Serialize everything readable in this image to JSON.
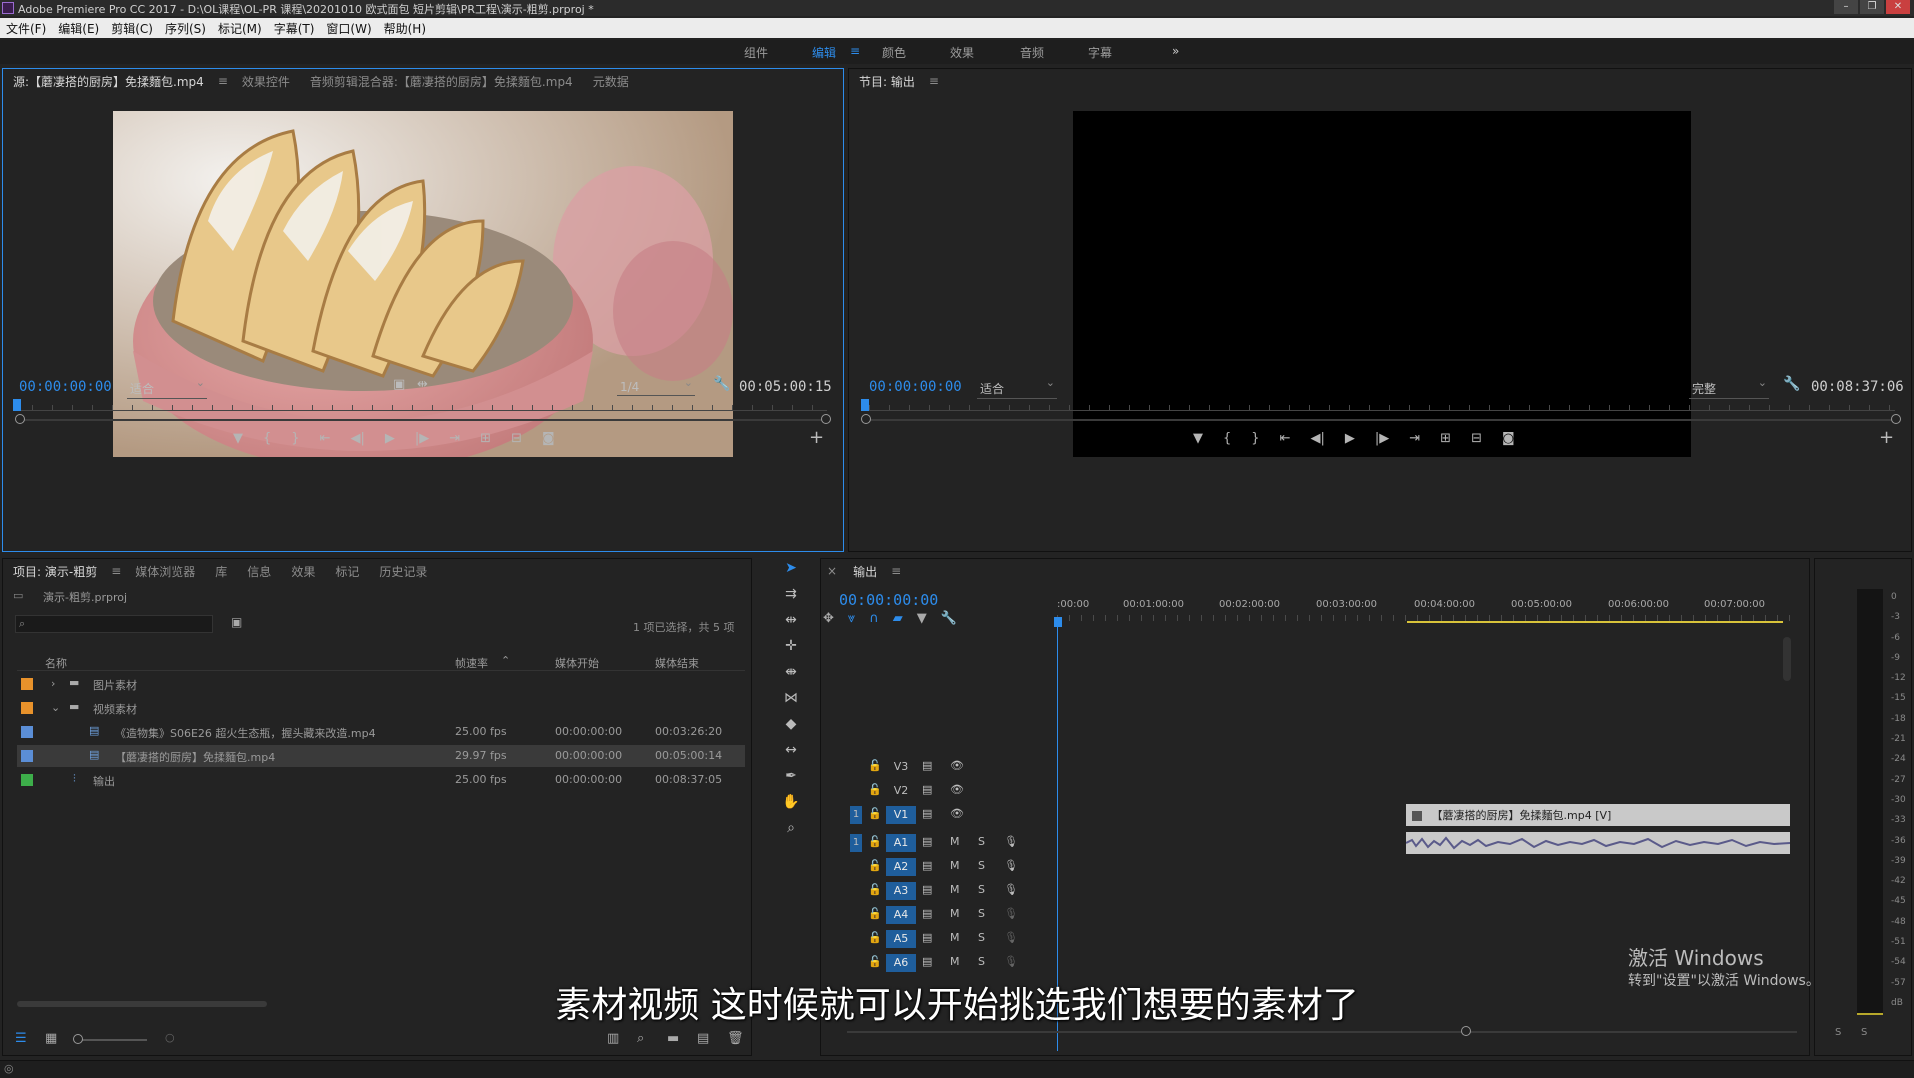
{
  "window": {
    "title": "Adobe Premiere Pro CC 2017 - D:\\OL课程\\OL-PR 课程\\20201010 欧式面包 短片剪辑\\PR工程\\演示-粗剪.prproj *"
  },
  "menu": [
    "文件(F)",
    "编辑(E)",
    "剪辑(C)",
    "序列(S)",
    "标记(M)",
    "字幕(T)",
    "窗口(W)",
    "帮助(H)"
  ],
  "workspaces": [
    "组件",
    "编辑",
    "颜色",
    "效果",
    "音频",
    "字幕"
  ],
  "workspace_active": "编辑",
  "workspace_more": "»",
  "source_panel": {
    "tabs": [
      "源:【蘑凄搭的厨房】免揉麵包.mp4",
      "效果控件",
      "音频剪辑混合器:【蘑凄搭的厨房】免揉麵包.mp4",
      "元数据"
    ],
    "timecode": "00:00:00:00",
    "fit": "适合",
    "resolution": "1/4",
    "duration": "00:05:00:15"
  },
  "program_panel": {
    "title": "节目: 输出",
    "timecode": "00:00:00:00",
    "fit": "适合",
    "quality": "完整",
    "duration": "00:08:37:06"
  },
  "project_panel": {
    "tabs": [
      "项目: 演示-粗剪",
      "媒体浏览器",
      "库",
      "信息",
      "效果",
      "标记",
      "历史记录"
    ],
    "file": "演示-粗剪.prproj",
    "selection_info": "1 项已选择，共 5 项",
    "columns": [
      "名称",
      "帧速率",
      "媒体开始",
      "媒体结束"
    ],
    "rows": [
      {
        "name": "图片素材",
        "fps": "",
        "start": "",
        "end": "",
        "color": "#e8922b",
        "type": "bin",
        "expanded": "›"
      },
      {
        "name": "视频素材",
        "fps": "",
        "start": "",
        "end": "",
        "color": "#e8922b",
        "type": "bin",
        "expanded": "⌄"
      },
      {
        "name": "《造物集》S06E26 超火生态瓶，握头藏来改造.mp4",
        "fps": "25.00 fps",
        "start": "00:00:00:00",
        "end": "00:03:26:20",
        "color": "#5b8ed6",
        "type": "clip"
      },
      {
        "name": "【蘑凄搭的厨房】免揉麵包.mp4",
        "fps": "29.97 fps",
        "start": "00:00:00:00",
        "end": "00:05:00:14",
        "color": "#5b8ed6",
        "type": "clip"
      },
      {
        "name": "输出",
        "fps": "25.00 fps",
        "start": "00:00:00:00",
        "end": "00:08:37:05",
        "color": "#3dae4a",
        "type": "sequence"
      }
    ]
  },
  "timeline": {
    "title": "输出",
    "timecode": "00:00:00:00",
    "ruler": [
      ":00:00",
      "00:01:00:00",
      "00:02:00:00",
      "00:03:00:00",
      "00:04:00:00",
      "00:05:00:00",
      "00:06:00:00",
      "00:07:00:00"
    ],
    "tracks": [
      "V3",
      "V2",
      "V1",
      "A1",
      "A2",
      "A3",
      "A4",
      "A5",
      "A6"
    ],
    "mute": "M",
    "solo": "S",
    "track_num": "1",
    "clip_label": "【蘑凄搭的厨房】免揉麵包.mp4 [V]"
  },
  "meter_scale": [
    "0",
    "-3",
    "-6",
    "-9",
    "-12",
    "-15",
    "-18",
    "-21",
    "-24",
    "-27",
    "-30",
    "-33",
    "-36",
    "-39",
    "-42",
    "-45",
    "-48",
    "-51",
    "-54",
    "-57",
    "dB"
  ],
  "meter_bottom": [
    "S",
    "S"
  ],
  "subtitle": "素材视频 这时候就可以开始挑选我们想要的素材了",
  "watermark": {
    "line1": "激活 Windows",
    "line2": "转到\"设置\"以激活 Windows。"
  }
}
